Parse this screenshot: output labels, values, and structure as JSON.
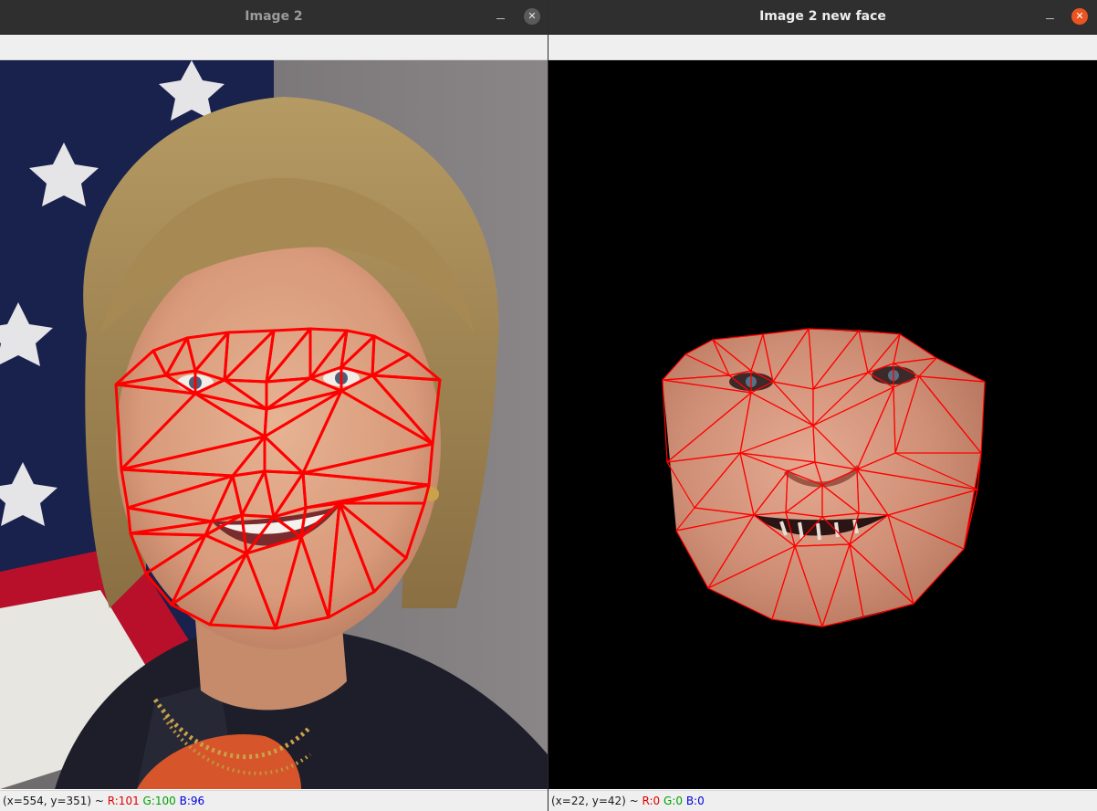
{
  "windows": [
    {
      "title": "Image 2",
      "status": {
        "coords": "(x=554, y=351) ~ ",
        "r": "R:101",
        "g": "G:100",
        "b": "B:96"
      }
    },
    {
      "title": "Image 2 new face",
      "status": {
        "coords": "(x=22, y=42) ~ ",
        "r": "R:0",
        "g": "G:0",
        "b": "B:0"
      }
    }
  ],
  "colors": {
    "mesh": "#ff0000",
    "close_active": "#e95420",
    "titlebar": "#2f2f2f"
  },
  "icons": {
    "minimize": "minimize-icon",
    "close": "close-icon"
  }
}
